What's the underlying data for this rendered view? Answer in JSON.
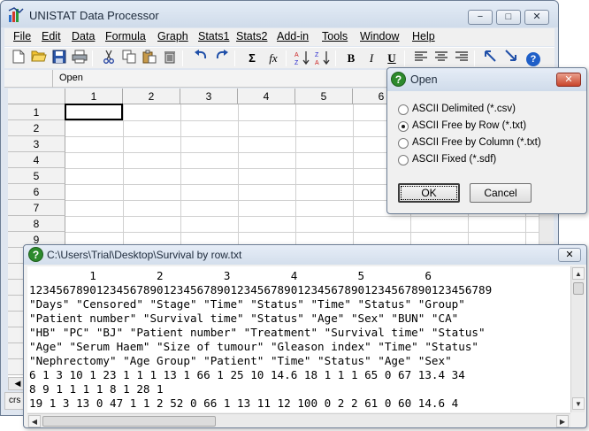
{
  "app": {
    "title": "UNISTAT Data Processor",
    "caption_buttons": [
      "−",
      "□",
      "✕"
    ]
  },
  "menu": [
    "File",
    "Edit",
    "Data",
    "Formula",
    "Graph",
    "Stats1",
    "Stats2",
    "Add-in",
    "Tools",
    "Window",
    "Help"
  ],
  "toolbar": {
    "icons": [
      "new-file-icon",
      "open-folder-icon",
      "save-icon",
      "print-icon",
      "cut-icon",
      "copy-icon",
      "paste-icon",
      "delete-icon",
      "undo-icon",
      "redo-icon",
      "sum-icon",
      "function-icon",
      "sort-ascending-icon",
      "sort-descending-icon",
      "bold-icon",
      "italic-icon",
      "underline-icon",
      "align-left-icon",
      "align-center-icon",
      "align-right-icon",
      "arrow-up-left-icon",
      "arrow-down-right-icon",
      "help-icon"
    ],
    "sum_glyph": "Σ",
    "fx_glyph": "fx",
    "bold": "B",
    "italic": "I",
    "underline": "U",
    "help_glyph": "?"
  },
  "cell_editor": {
    "content": "Open"
  },
  "grid": {
    "columns": [
      "1",
      "2",
      "3",
      "4",
      "5",
      "6"
    ],
    "rows": [
      "1",
      "2",
      "3",
      "4",
      "5",
      "6",
      "7",
      "8",
      "9"
    ]
  },
  "statusbar": {
    "text": "crs"
  },
  "open_dialog": {
    "title": "Open",
    "close": "✕",
    "options": [
      {
        "label": "ASCII Delimited (*.csv)",
        "selected": false
      },
      {
        "label": "ASCII Free by Row (*.txt)",
        "selected": true
      },
      {
        "label": "ASCII Free by Column (*.txt)",
        "selected": false
      },
      {
        "label": "ASCII Fixed (*.sdf)",
        "selected": false
      }
    ],
    "ok_label": "OK",
    "cancel_label": "Cancel"
  },
  "text_window": {
    "title": "C:\\Users\\Trial\\Desktop\\Survival by row.txt",
    "close": "✕",
    "ruler_numbers": "         1         2         3         4         5         6",
    "ruler_digits": "123456789012345678901234567890123456789012345678901234567890123456789",
    "lines": [
      "\"Days\" \"Censored\" \"Stage\" \"Time\" \"Status\" \"Time\" \"Status\" \"Group\"",
      "\"Patient number\" \"Survival time\" \"Status\" \"Age\" \"Sex\" \"BUN\" \"CA\"",
      "\"HB\" \"PC\" \"BJ\" \"Patient number\" \"Treatment\" \"Survival time\" \"Status\"",
      "\"Age\" \"Serum Haem\" \"Size of tumour\" \"Gleason index\" \"Time\" \"Status\"",
      "\"Nephrectomy\" \"Age Group\" \"Patient\" \"Time\" \"Status\" \"Age\" \"Sex\"",
      "6 1 3 10 1 23 1 1 1 13 1 66 1 25 10 14.6 18 1 1 1 65 0 67 13.4 34",
      "8 9 1 1 1 1 8 1 28 1",
      "19 1 3 13 0 47 1 1 2 52 0 66 1 13 11 12 100 0 2 2 61 0 60 14.6 4"
    ]
  }
}
